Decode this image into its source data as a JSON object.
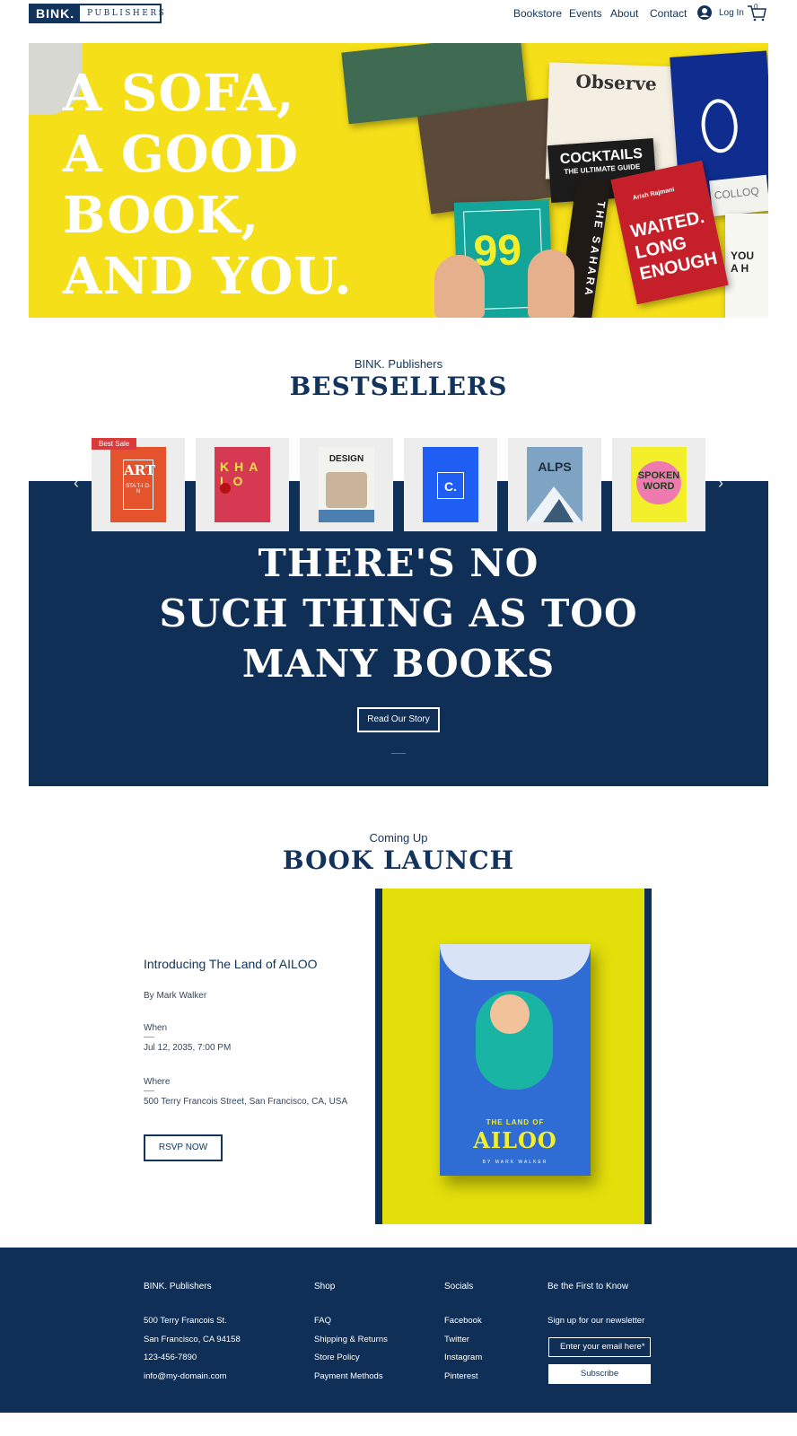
{
  "header": {
    "logo_bold": "BINK.",
    "logo_light": "PUBLISHERS",
    "nav": [
      "Bookstore",
      "Events",
      "About",
      "Contact"
    ],
    "login_label": "Log In",
    "cart_count": "0"
  },
  "hero": {
    "title_lines": [
      "A SOFA,",
      "A GOOD",
      "BOOK,",
      "AND YOU."
    ],
    "book_titles": {
      "observe": "Observe",
      "cocktails": "COCKTAILS",
      "cocktails_sub": "THE ULTIMATE GUIDE",
      "waited": "WAITED. LONG ENOUGH",
      "waited_author": "Arish Rajmani",
      "sahara": "THE SAHARA",
      "colloq": "COLLOQ",
      "you": "YOU A H",
      "ninety_nine": "99"
    }
  },
  "bestsellers": {
    "subtitle": "BINK. Publishers",
    "title": "BESTSELLERS",
    "badge": "Best Sale",
    "books": [
      {
        "title": "ART",
        "sub": "STA T-I O-N",
        "bg": "#e5532d"
      },
      {
        "title": "KHALO",
        "bg": "#d63a52"
      },
      {
        "title": "DESIGN",
        "bg": "#f2f2ee"
      },
      {
        "title": "C.",
        "bg": "#1f5ef2"
      },
      {
        "title": "ALPS",
        "bg": "#7fa3c2"
      },
      {
        "title": "SPOKEN WORD",
        "bg": "#f3ef2a"
      }
    ]
  },
  "banner": {
    "lines": [
      "THERE'S NO",
      "SUCH THING AS TOO",
      "MANY BOOKS"
    ],
    "button": "Read Our Story"
  },
  "launch": {
    "subtitle": "Coming Up",
    "title": "BOOK LAUNCH",
    "event_title": "Introducing The Land of AILOO",
    "author": "By Mark Walker",
    "when_label": "When",
    "when_value": "Jul 12, 2035, 7:00 PM",
    "where_label": "Where",
    "where_value": "500 Terry Francois Street, San Francisco, CA, USA",
    "button": "RSVP NOW",
    "cover_small": "THE LAND OF",
    "cover_title": "AILOO",
    "cover_author": "BY MARK WALKER"
  },
  "footer": {
    "col1_head": "BINK. Publishers",
    "col1": [
      "500 Terry Francois St.",
      "San Francisco, CA 94158",
      "123-456-7890",
      "info@my-domain.com"
    ],
    "col2_head": "Shop",
    "col2": [
      "FAQ",
      "Shipping & Returns",
      "Store Policy",
      "Payment Methods"
    ],
    "col3_head": "Socials",
    "col3": [
      "Facebook",
      "Twitter",
      "Instagram",
      "Pinterest"
    ],
    "col4_head": "Be the First to Know",
    "newsletter_text": "Sign up for our newsletter",
    "email_placeholder": "Enter your email here*",
    "subscribe": "Subscribe"
  },
  "colors": {
    "navy": "#0f2f57",
    "hero_yellow": "#f5df18",
    "launch_yellow": "#e3df0a",
    "badge_red": "#d93a3a"
  }
}
